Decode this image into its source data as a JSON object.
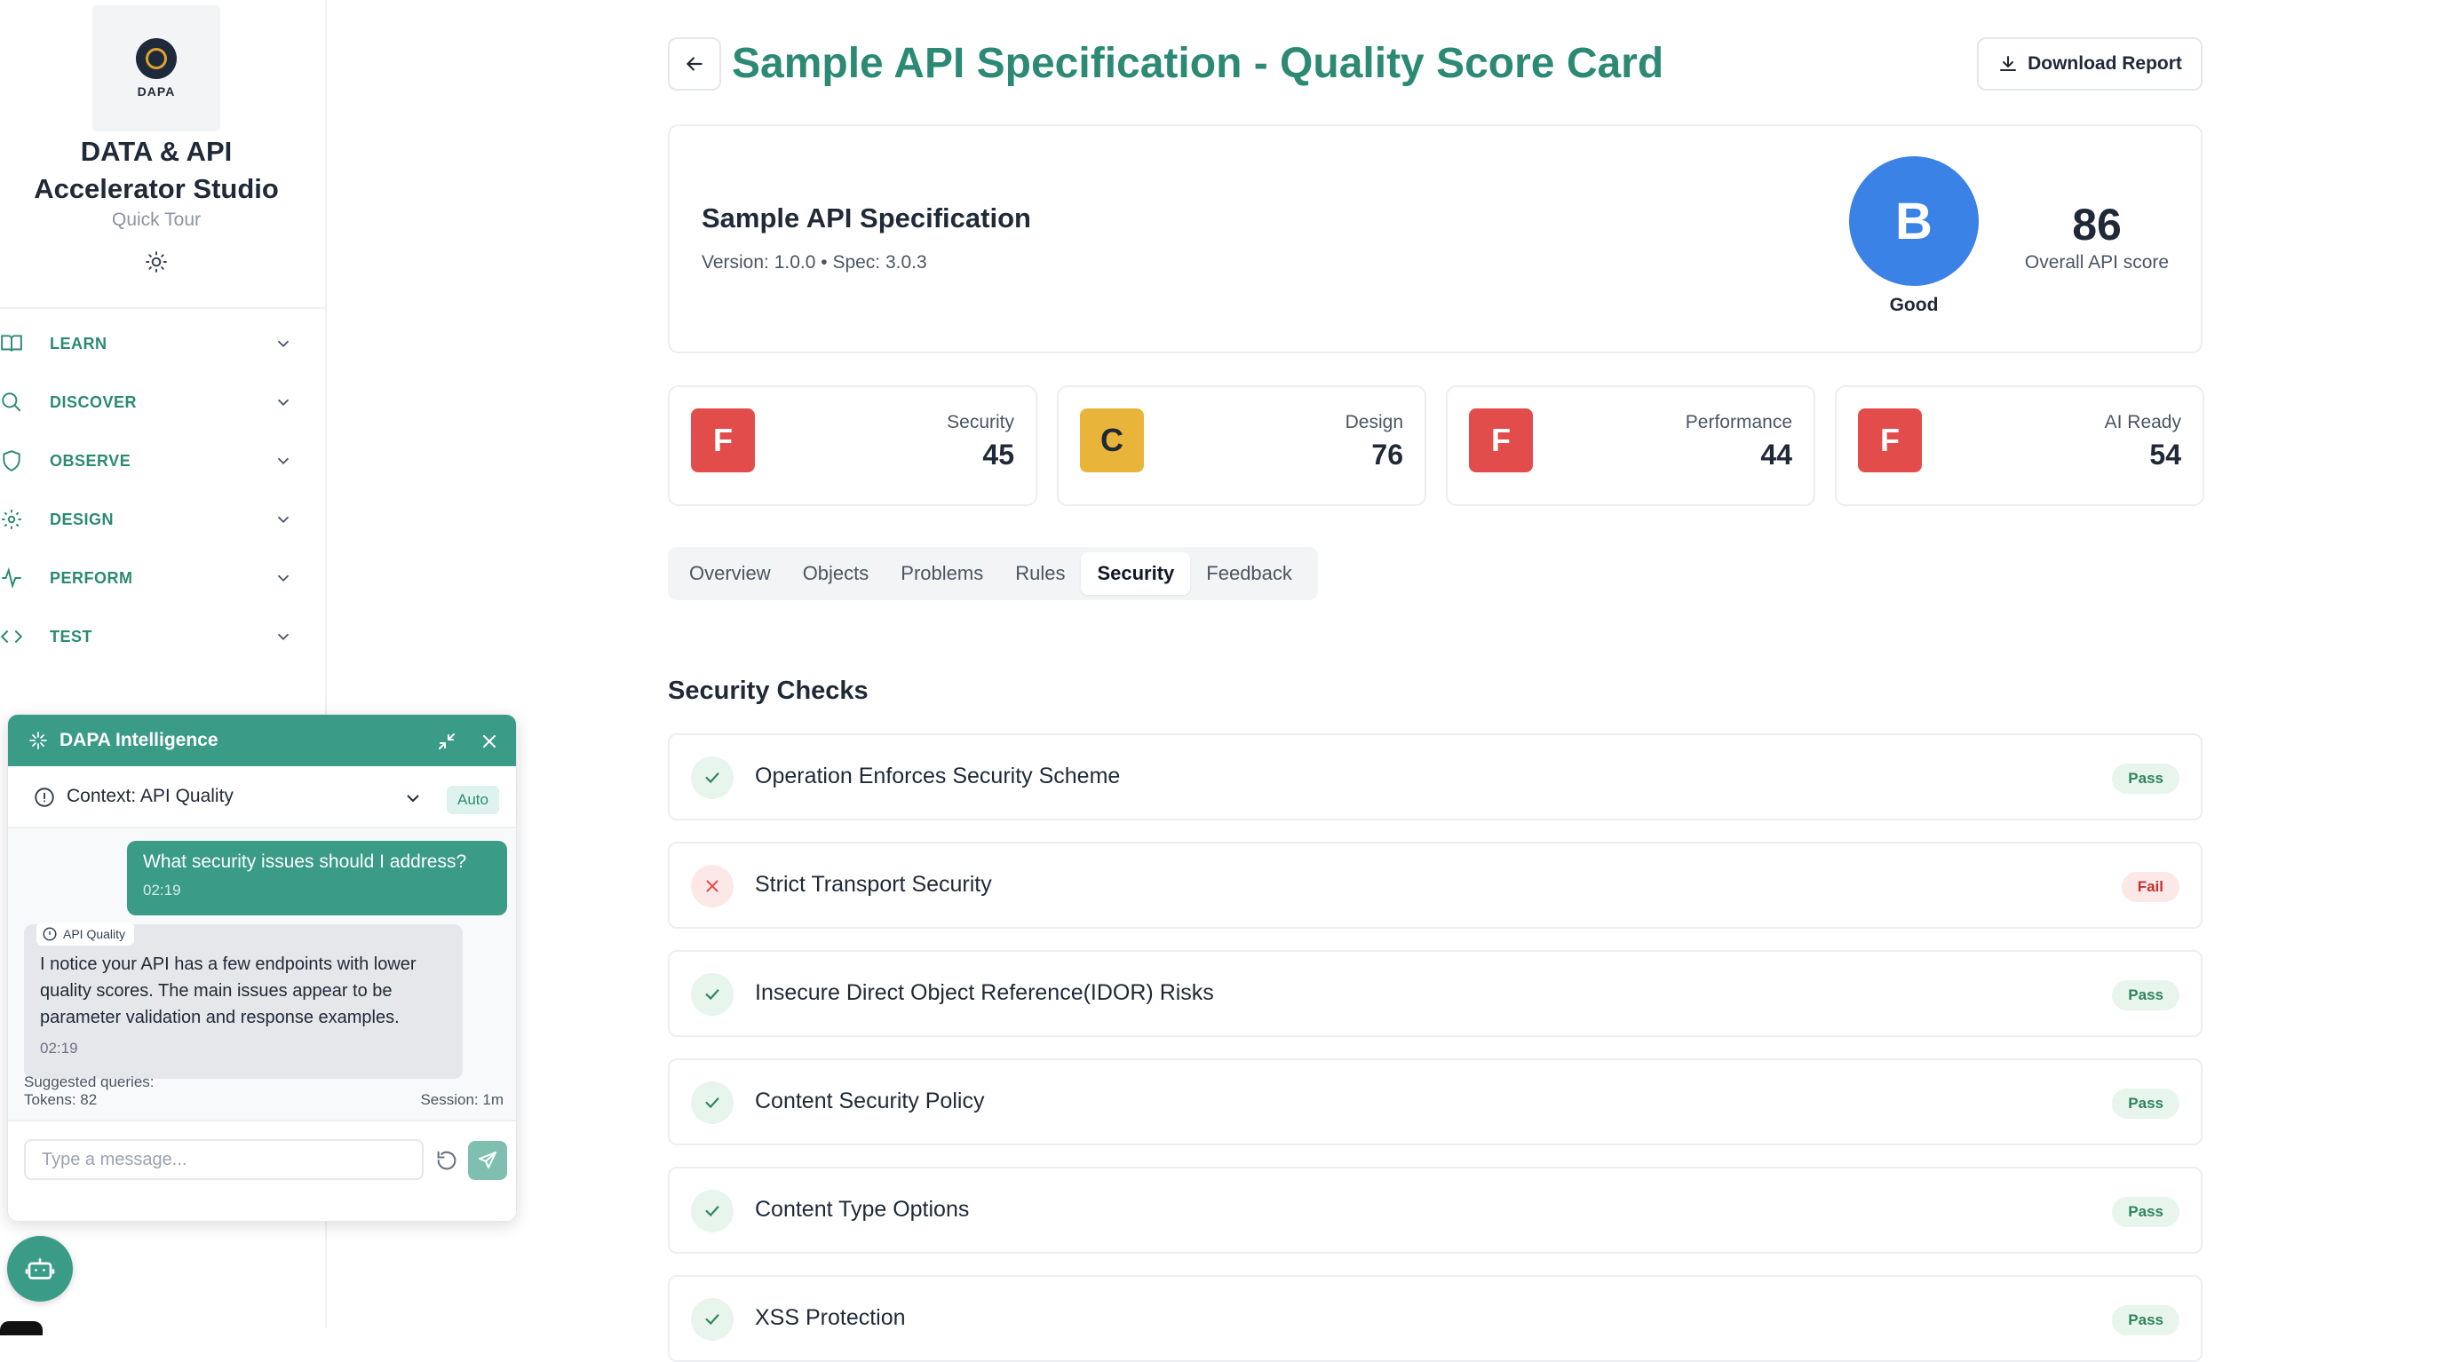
{
  "sidebar": {
    "logo_text": "DAPA",
    "app_title_line1": "DATA & API",
    "app_title_line2": "Accelerator Studio",
    "quick_tour": "Quick Tour",
    "items": [
      {
        "label": "LEARN",
        "icon": "book-icon"
      },
      {
        "label": "DISCOVER",
        "icon": "search-icon"
      },
      {
        "label": "OBSERVE",
        "icon": "shield-icon"
      },
      {
        "label": "DESIGN",
        "icon": "gear-icon"
      },
      {
        "label": "PERFORM",
        "icon": "activity-icon"
      },
      {
        "label": "TEST",
        "icon": "code-icon"
      }
    ]
  },
  "header": {
    "title": "Sample API Specification - Quality Score Card",
    "download_label": "Download Report"
  },
  "summary": {
    "api_name": "Sample API Specification",
    "meta": "Version: 1.0.0 • Spec: 3.0.3",
    "grade": "B",
    "grade_word": "Good",
    "overall_score": "86",
    "overall_label": "Overall API score"
  },
  "categories": [
    {
      "grade": "F",
      "name": "Security",
      "score": "45"
    },
    {
      "grade": "C",
      "name": "Design",
      "score": "76"
    },
    {
      "grade": "F",
      "name": "Performance",
      "score": "44"
    },
    {
      "grade": "F",
      "name": "AI Ready",
      "score": "54"
    }
  ],
  "tabs": [
    "Overview",
    "Objects",
    "Problems",
    "Rules",
    "Security",
    "Feedback"
  ],
  "active_tab": "Security",
  "security": {
    "title": "Security Checks",
    "checks": [
      {
        "name": "Operation Enforces Security Scheme",
        "status": "Pass"
      },
      {
        "name": "Strict Transport Security",
        "status": "Fail"
      },
      {
        "name": "Insecure Direct Object Reference(IDOR) Risks",
        "status": "Pass"
      },
      {
        "name": "Content Security Policy",
        "status": "Pass"
      },
      {
        "name": "Content Type Options",
        "status": "Pass"
      },
      {
        "name": "XSS Protection",
        "status": "Pass"
      }
    ]
  },
  "chat": {
    "title": "DAPA Intelligence",
    "context_label": "Context: API Quality",
    "context_mode": "Auto",
    "user_message": "What security issues should I address?",
    "user_time": "02:19",
    "bot_tag": "API Quality",
    "bot_message": "I notice your API has a few endpoints with lower quality scores. The main issues appear to be parameter validation and response examples.",
    "bot_time": "02:19",
    "suggested_label": "Suggested queries:",
    "tokens": "Tokens: 82",
    "session": "Session: 1m",
    "input_placeholder": "Type a message..."
  },
  "colors": {
    "brand": "#2c8a74",
    "chat_header": "#3a9b86",
    "grade_b": "#3b82e6",
    "grade_f": "#e24c4b",
    "grade_c": "#e8b53a",
    "pass": "#2f855a",
    "fail": "#c53030"
  }
}
